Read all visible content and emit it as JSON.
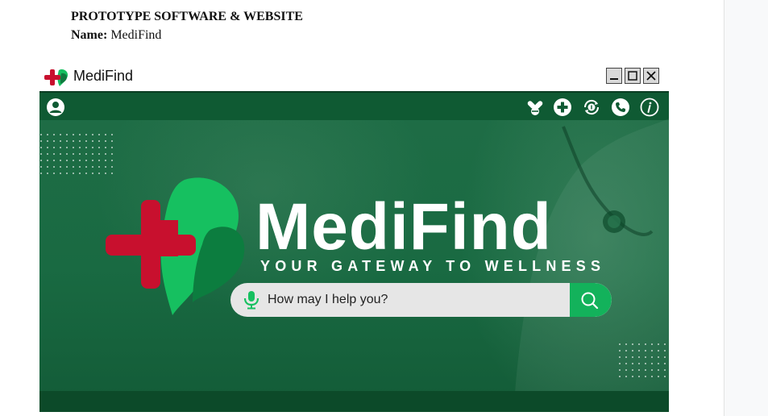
{
  "document": {
    "title": "PROTOTYPE SOFTWARE & WEBSITE",
    "name_label": "Name:",
    "name_value": "MediFind"
  },
  "window": {
    "title": "MediFind",
    "controls": [
      "minimize-icon",
      "maximize-icon",
      "close-icon"
    ]
  },
  "nav": {
    "left_icons": [
      "user-profile-icon"
    ],
    "right_icons": [
      "pills-icon",
      "medical-cross-icon",
      "refill-exchange-icon",
      "phone-icon",
      "info-icon"
    ]
  },
  "hero": {
    "brand_name": "MediFind",
    "tagline": "YOUR GATEWAY TO WELLNESS"
  },
  "search": {
    "placeholder": "How may I help you?",
    "value": ""
  },
  "colors": {
    "primary_green": "#196a42",
    "nav_green": "#0f5a33",
    "accent_green": "#13b25b",
    "logo_red": "#c8102e",
    "logo_green": "#16c060"
  }
}
